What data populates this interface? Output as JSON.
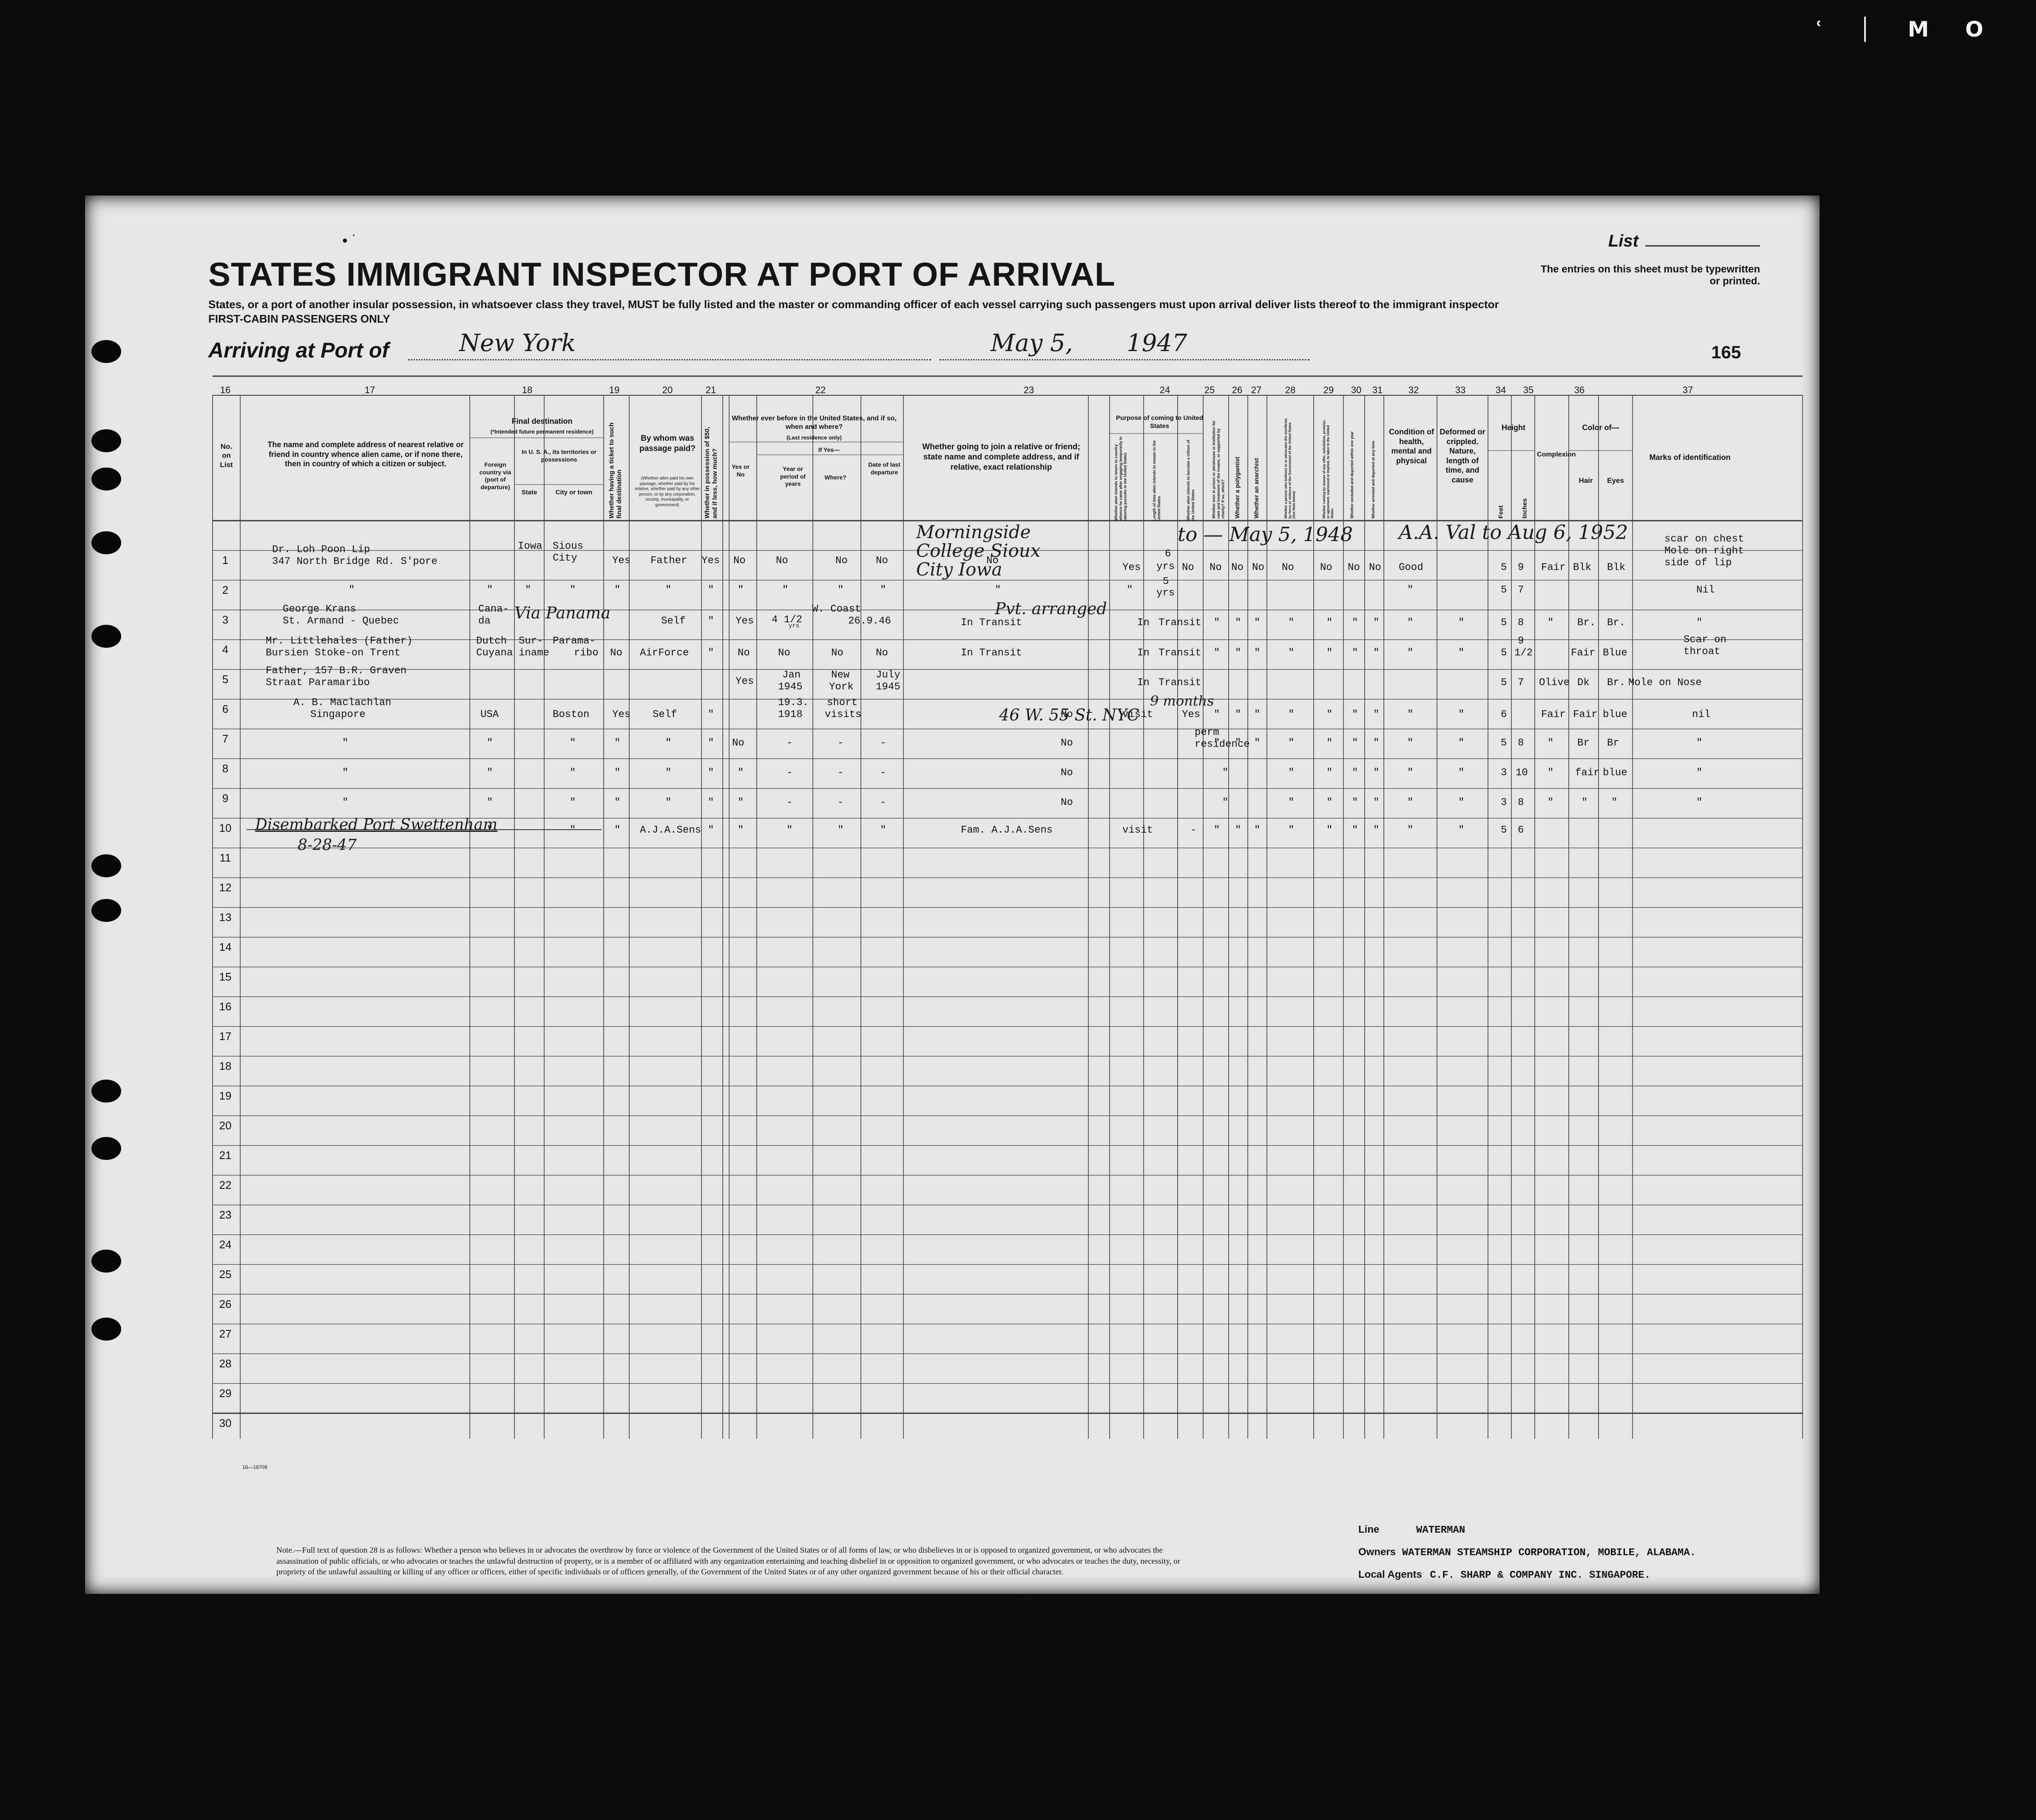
{
  "corner_marks": "ʿ │ M O",
  "form": {
    "top_dots": "• ˙",
    "title": "STATES IMMIGRANT INSPECTOR AT PORT OF ARRIVAL",
    "subtitle_line1": "States, or a port of another insular possession, in whatsoever class they travel, MUST be fully listed and the master or commanding officer of each vessel carrying such passengers must upon arrival deliver lists thereof to the immigrant inspector",
    "subtitle_line2": "FIRST-CABIN PASSENGERS ONLY",
    "list_label": "List",
    "entries_note": "The entries on this sheet must be typewritten or printed.",
    "arriving_label": "Arriving at Port of",
    "port": "New York",
    "date": "May 5,",
    "year": "1947",
    "page_number": "165"
  },
  "columns": {
    "numbers": [
      "16",
      "17",
      "18",
      "19",
      "20",
      "21",
      "22",
      "23",
      "24",
      "25",
      "26",
      "27",
      "28",
      "29",
      "30",
      "31",
      "32",
      "33",
      "34",
      "35",
      "36",
      "37"
    ],
    "c16": "No. on List",
    "c17": "The name and complete address of nearest relative or friend in country whence alien came, or if none there, then in country of which a citizen or subject.",
    "c18_title": "Final destination",
    "c18_note": "(*Intended future permanent residence)",
    "c18_foreign": "Foreign country via (port of departure)",
    "c18_usa": "In U. S. A., its territories or possessions",
    "c18_state": "State",
    "c18_city": "City or town",
    "c19": "Whether having a ticket to such final destination",
    "c20_title": "By whom was passage paid?",
    "c20_note": "(Whether alien paid his own passage, whether paid by his relative, whether paid by any other person, or by any corporation, society, municipality, or government)",
    "c21": "Whether in possession of $50, and if less, how much?",
    "c22_title": "Whether ever before in the United States, and if so, when and where?",
    "c22_note": "(Last residence only)",
    "c22_ifyes": "If Yes—",
    "c22_yesno": "Yes or No",
    "c22_year": "Year or period of years",
    "c22_where": "Where?",
    "c22_date": "Date of last departure",
    "c23": "Whether going to join a relative or friend; state name and complete address, and if relative, exact relationship",
    "c24_title": "Purpose of coming to United States",
    "c24_a": "Whether alien intends to return to country whence he came after engaging temporarily in laboring pursuits in the United States",
    "c24_b": "Length of time alien intends to remain in the United States",
    "c24_c": "Whether alien intends to become a citizen of the United States",
    "c25": "Whether ever in prison or almshouse or institution for care and treatment of the insane, or supported by charity? If so, which?",
    "c26": "Whether a polygamist",
    "c27": "Whether an anarchist",
    "c28": "Whether a person who believes in or advocates the overthrow by force or violence of the Government of the United States (See Note below)",
    "c29": "Whether coming by reason of any offer, solicitation, promise, or agreement, expressed or implied, to labor in the United States",
    "c30": "Whether excluded and deported within one year",
    "c31": "Whether arrested and deported at any time",
    "c32": "Condition of health, mental and physical",
    "c33": "Deformed or crippled. Nature, length of time, and cause",
    "c34": "Height",
    "c34_feet": "Feet",
    "c34_inches": "Inches",
    "c35": "Complexion",
    "c36": "Color of—",
    "c36_hair": "Hair",
    "c36_eyes": "Eyes",
    "c37": "Marks of identification"
  },
  "row_numbers": [
    "1",
    "2",
    "3",
    "4",
    "5",
    "6",
    "7",
    "8",
    "9",
    "10",
    "11",
    "12",
    "13",
    "14",
    "15",
    "16",
    "17",
    "18",
    "19",
    "20",
    "21",
    "22",
    "23",
    "24",
    "25",
    "26",
    "27",
    "28",
    "29",
    "30"
  ],
  "entries": {
    "r1_name1": "Dr. Loh Poon Lip",
    "r1_name2": "347 North Bridge Rd. S'pore",
    "r1_state": "Iowa",
    "r1_city1": "Sious",
    "r1_city2": "City",
    "r1_ticket": "Yes",
    "r1_paid": "Father",
    "r1_money": "Yes",
    "r1_before": "No",
    "r1_year": "No",
    "r1_where": "No",
    "r1_depart": "No",
    "r1_join": "No",
    "r1_join_hand": "Morningside College Sioux City Iowa",
    "r1_return": "Yes",
    "r1_length1": "6",
    "r1_length2": "yrs",
    "r1_citizen": "No",
    "r1_c25": "No",
    "r1_c26": "No",
    "r1_c27": "No",
    "r1_c28": "No",
    "r1_c29": "No",
    "r1_c30": "No",
    "r1_c31": "No",
    "r1_health": "Good",
    "r1_feet": "5",
    "r1_inches": "9",
    "r1_complexion": "Fair",
    "r1_hair": "Blk",
    "r1_eyes": "Blk",
    "r1_marks1": "scar on chest",
    "r1_marks2": "Mole on right",
    "r1_marks3": "side of lip",
    "r1_hand_mid": "to — May 5, 1948",
    "r1_hand_right": "A.A. Val to Aug 6, 1952",
    "r2_length1": "5",
    "r2_length2": "yrs",
    "r2_feet": "5",
    "r2_inches": "7",
    "r2_marks": "Nil",
    "r3_name1": "George Krans",
    "r3_name2": "St. Armand - Quebec",
    "r3_foreign1": "Cana-",
    "r3_foreign2": "da",
    "r3_paid": "Self",
    "r3_before": "Yes",
    "r3_year1": "4 1/2",
    "r3_year2": "yrs",
    "r3_where": "W. Coast",
    "r3_depart": "26.9.46",
    "r3_join": "In Transit",
    "r3_purpose": "In",
    "r3_length": "Transit",
    "r3_feet": "5",
    "r3_inches": "8",
    "r3_hair": "Br.",
    "r3_eyes": "Br.",
    "r3_hand_dest": "Via Panama",
    "r3_hand_join": "Pvt. arranged",
    "r4_name1": "Mr. Littlehales (Father)",
    "r4_name2": "Bursien Stoke-on Trent",
    "r4_foreign1": "Dutch",
    "r4_foreign2": "Cuyana",
    "r4_state1": "Sur-",
    "r4_state2": "iname",
    "r4_city1": "Parama-",
    "r4_city2": "ribo",
    "r4_ticket": "No",
    "r4_paid": "AirForce",
    "r4_before": "No",
    "r4_year": "No",
    "r4_where": "No",
    "r4_depart": "No",
    "r4_join": "In Transit",
    "r4_purpose": "In",
    "r4_length": "Transit",
    "r4_feet": "5",
    "r4_inches1": "9",
    "r4_inches2": "1/2",
    "r4_complexion": "Fair",
    "r4_hair": "Blue",
    "r4_marks1": "Scar on",
    "r4_marks2": "throat",
    "r5_name1": "Father, 157 B.R. Graven",
    "r5_name2": "Straat Paramaribo",
    "r5_before": "Yes",
    "r5_year1": "Jan",
    "r5_year2": "1945",
    "r5_where1": "New",
    "r5_where2": "York",
    "r5_depart1": "July",
    "r5_depart2": "1945",
    "r5_purpose": "In",
    "r5_length": "Transit",
    "r5_feet": "5",
    "r5_inches": "7",
    "r5_complexion": "Olive",
    "r5_hair": "Dk",
    "r5_eyes": "Br.",
    "r5_marks": "Mole on Nose",
    "r6_name1": "A. B. Maclachlan",
    "r6_name2": "Singapore",
    "r6_foreign": "USA",
    "r6_city": "Boston",
    "r6_ticket": "Yes",
    "r6_paid": "Self",
    "r6_year1": "19.3.",
    "r6_year2": "1918",
    "r6_where1": "short",
    "r6_where2": "visits",
    "r6_join": "No",
    "r6_purpose": "visit",
    "r6_citizen": "Yes",
    "r6_feet": "6",
    "r6_complexion": "Fair",
    "r6_hair": "Fair",
    "r6_eyes": "blue",
    "r6_marks": "nil",
    "r6_hand_join": "46 W. 55 St. NYC",
    "r6_hand_length": "9 months",
    "r7_before": "No",
    "r7_join": "No",
    "r7_purpose1": "perm",
    "r7_purpose2": "residence",
    "r7_feet": "5",
    "r7_inches": "8",
    "r7_hair": "Br",
    "r7_eyes": "Br",
    "r8_join": "No",
    "r8_feet": "3",
    "r8_inches": "10",
    "r8_hair": "fair",
    "r8_eyes": "blue",
    "r9_join": "No",
    "r9_feet": "3",
    "r9_inches": "8",
    "r10_hand1": "Disembarked Port Swettenham",
    "r10_hand2": "8-28-47",
    "r10_paid": "A.J.A.Sens",
    "r10_join": "Fam. A.J.A.Sens",
    "r10_purpose": "visit",
    "r10_feet": "5",
    "r10_inches": "6",
    "ditto": "\"",
    "dash": "-"
  },
  "footer": {
    "form_code": "16—18709",
    "note": "Note.—Full text of question 28 is as follows: Whether a person who believes in or advocates the overthrow by force or violence of the Government of the United States or of all forms of law, or who disbelieves in or is opposed to organized government, or who advocates the assassination of public officials, or who advocates or teaches the unlawful destruction of property, or is a member of or affiliated with any organization entertaining and teaching disbelief in or opposition to organized government, or who advocates or teaches the duty, necessity, or propriety of the unlawful assaulting or killing of any officer or officers, either of specific individuals or of officers generally, of the Government of the United States or of any other organized government because of his or their official character.",
    "form_code2": "16—18709",
    "line_label": "Line",
    "line_value": "WATERMAN",
    "owners_label": "Owners",
    "owners_value": "WATERMAN STEAMSHIP CORPORATION, MOBILE, ALABAMA.",
    "agents_label": "Local Agents",
    "agents_value": "C.F. SHARP & COMPANY INC. SINGAPORE."
  }
}
